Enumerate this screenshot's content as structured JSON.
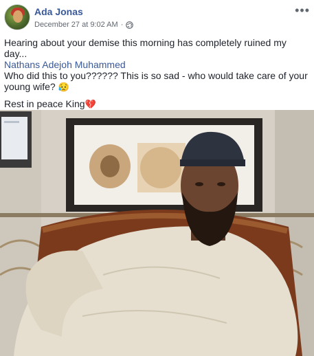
{
  "post": {
    "author": "Ada Jonas",
    "timestamp": "December 27 at 9:02 AM",
    "separator": "·",
    "privacy_icon": "globe-icon",
    "more_label": "•••",
    "lines": {
      "line1": "Hearing about your demise this morning has completely ruined my day...",
      "mention": "Nathans Adejoh Muhammed",
      "line3": "Who did this to you?????? This is so sad - who would take care of your young wife? ",
      "line3_emoji": "😥",
      "line4": "Rest in peace King",
      "line4_emoji": "💔"
    }
  },
  "colors": {
    "link": "#385898",
    "text": "#1d2129",
    "meta": "#616770"
  }
}
